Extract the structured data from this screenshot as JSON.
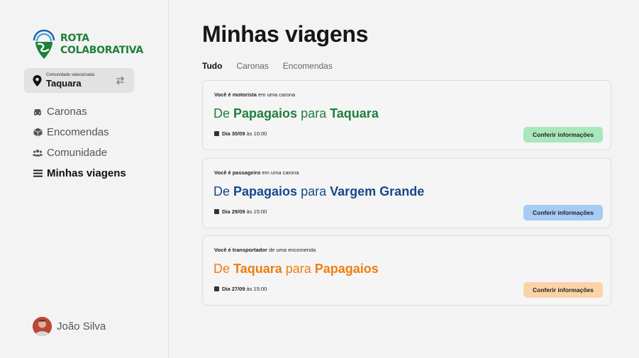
{
  "brand": {
    "line1": "ROTA",
    "line2": "COLABORATIVA",
    "color": "#1f7f3c"
  },
  "community": {
    "caption": "Comunidade selecionada:",
    "name": "Taquara",
    "icon": "map-pin-icon",
    "swap_icon": "swap-arrows-icon"
  },
  "nav": {
    "items": [
      {
        "label": "Caronas",
        "icon": "car-icon"
      },
      {
        "label": "Encomendas",
        "icon": "box-icon"
      },
      {
        "label": "Comunidade",
        "icon": "users-icon"
      },
      {
        "label": "Minhas viagens",
        "icon": "menu-icon",
        "active": true
      }
    ]
  },
  "user": {
    "name": "João Silva"
  },
  "page": {
    "title": "Minhas viagens"
  },
  "tabs": [
    {
      "label": "Tudo",
      "active": true
    },
    {
      "label": "Caronas"
    },
    {
      "label": "Encomendas"
    }
  ],
  "trips": [
    {
      "role_bold": "Você é motorista",
      "role_rest": "em uma carona",
      "de": "De",
      "from": "Papagaios",
      "para": "para",
      "to": "Taquara",
      "date_bold": "Dia 30/09",
      "time": "às 10:00",
      "button": "Conferir informações",
      "color": "#1f7f3c",
      "button_color": "#a8e6bb"
    },
    {
      "role_bold": "Você é passageiro",
      "role_rest": "em uma carona",
      "de": "De",
      "from": "Papagaios",
      "para": "para",
      "to": "Vargem Grande",
      "date_bold": "Dia 29/09",
      "time": "às 15:00",
      "button": "Conferir informações",
      "color": "#16488c",
      "button_color": "#a6cbf5"
    },
    {
      "role_bold": "Você é transportador",
      "role_rest": "de uma encomenda",
      "de": "De",
      "from": "Taquara",
      "para": "para",
      "to": "Papagaios",
      "date_bold": "Dia 27/09",
      "time": "às 15:00",
      "button": "Conferir informações",
      "color": "#f07d12",
      "button_color": "#fbd3a8"
    }
  ]
}
